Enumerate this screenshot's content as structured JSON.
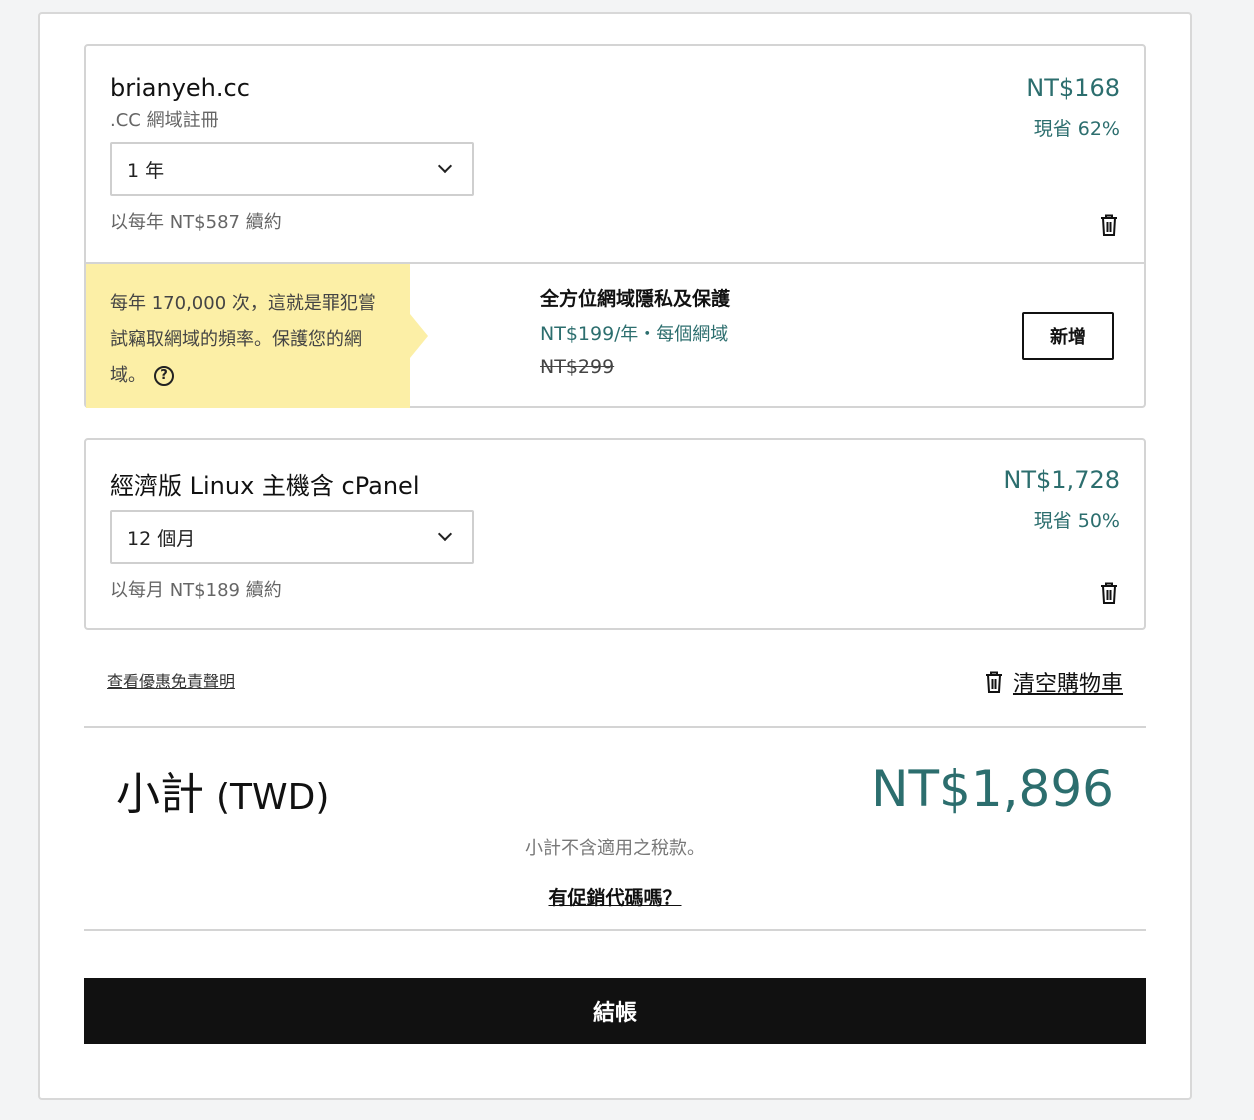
{
  "cart": {
    "domain_item": {
      "name": "brianyeh.cc",
      "type": ".CC 網域註冊",
      "term_selected": "1 年",
      "renewal": "以每年 NT$587 續約",
      "price": "NT$168",
      "savings": "現省 62%",
      "delete_icon": "trash-icon"
    },
    "upsell": {
      "callout_text": "每年 170,000 次，這就是罪犯嘗試竊取網域的頻率。保護您的網域。",
      "help_icon": "question-circle-icon",
      "title": "全方位網域隱私及保護",
      "price": "NT$199",
      "price_suffix": "/年・每個網域",
      "original_price": "NT$299",
      "add_label": "新增"
    },
    "hosting_item": {
      "name": "經濟版 Linux 主機含 cPanel",
      "term_selected": "12 個月",
      "renewal": "以每月 NT$189 續約",
      "price": "NT$1,728",
      "savings": "現省 50%",
      "delete_icon": "trash-icon"
    },
    "links": {
      "disclaimer": "查看優惠免責聲明",
      "clear_cart": "清空購物車"
    },
    "summary": {
      "subtotal_label": "小計",
      "currency_label": "(TWD)",
      "subtotal_amount": "NT$1,896",
      "tax_note": "小計不含適用之稅款。",
      "promo_link": "有促銷代碼嗎？",
      "checkout_label": "結帳"
    }
  },
  "colors": {
    "accent_teal": "#2c6e6e",
    "callout_yellow": "#fcefa6",
    "checkout_black": "#111111"
  }
}
